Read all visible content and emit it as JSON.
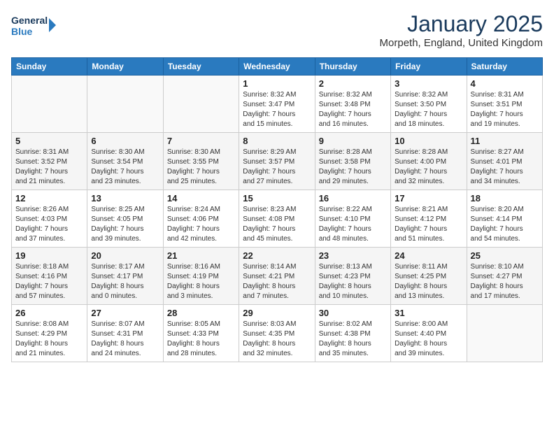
{
  "header": {
    "logo_line1": "General",
    "logo_line2": "Blue",
    "title": "January 2025",
    "subtitle": "Morpeth, England, United Kingdom"
  },
  "weekdays": [
    "Sunday",
    "Monday",
    "Tuesday",
    "Wednesday",
    "Thursday",
    "Friday",
    "Saturday"
  ],
  "weeks": [
    [
      {
        "day": "",
        "info": ""
      },
      {
        "day": "",
        "info": ""
      },
      {
        "day": "",
        "info": ""
      },
      {
        "day": "1",
        "info": "Sunrise: 8:32 AM\nSunset: 3:47 PM\nDaylight: 7 hours\nand 15 minutes."
      },
      {
        "day": "2",
        "info": "Sunrise: 8:32 AM\nSunset: 3:48 PM\nDaylight: 7 hours\nand 16 minutes."
      },
      {
        "day": "3",
        "info": "Sunrise: 8:32 AM\nSunset: 3:50 PM\nDaylight: 7 hours\nand 18 minutes."
      },
      {
        "day": "4",
        "info": "Sunrise: 8:31 AM\nSunset: 3:51 PM\nDaylight: 7 hours\nand 19 minutes."
      }
    ],
    [
      {
        "day": "5",
        "info": "Sunrise: 8:31 AM\nSunset: 3:52 PM\nDaylight: 7 hours\nand 21 minutes."
      },
      {
        "day": "6",
        "info": "Sunrise: 8:30 AM\nSunset: 3:54 PM\nDaylight: 7 hours\nand 23 minutes."
      },
      {
        "day": "7",
        "info": "Sunrise: 8:30 AM\nSunset: 3:55 PM\nDaylight: 7 hours\nand 25 minutes."
      },
      {
        "day": "8",
        "info": "Sunrise: 8:29 AM\nSunset: 3:57 PM\nDaylight: 7 hours\nand 27 minutes."
      },
      {
        "day": "9",
        "info": "Sunrise: 8:28 AM\nSunset: 3:58 PM\nDaylight: 7 hours\nand 29 minutes."
      },
      {
        "day": "10",
        "info": "Sunrise: 8:28 AM\nSunset: 4:00 PM\nDaylight: 7 hours\nand 32 minutes."
      },
      {
        "day": "11",
        "info": "Sunrise: 8:27 AM\nSunset: 4:01 PM\nDaylight: 7 hours\nand 34 minutes."
      }
    ],
    [
      {
        "day": "12",
        "info": "Sunrise: 8:26 AM\nSunset: 4:03 PM\nDaylight: 7 hours\nand 37 minutes."
      },
      {
        "day": "13",
        "info": "Sunrise: 8:25 AM\nSunset: 4:05 PM\nDaylight: 7 hours\nand 39 minutes."
      },
      {
        "day": "14",
        "info": "Sunrise: 8:24 AM\nSunset: 4:06 PM\nDaylight: 7 hours\nand 42 minutes."
      },
      {
        "day": "15",
        "info": "Sunrise: 8:23 AM\nSunset: 4:08 PM\nDaylight: 7 hours\nand 45 minutes."
      },
      {
        "day": "16",
        "info": "Sunrise: 8:22 AM\nSunset: 4:10 PM\nDaylight: 7 hours\nand 48 minutes."
      },
      {
        "day": "17",
        "info": "Sunrise: 8:21 AM\nSunset: 4:12 PM\nDaylight: 7 hours\nand 51 minutes."
      },
      {
        "day": "18",
        "info": "Sunrise: 8:20 AM\nSunset: 4:14 PM\nDaylight: 7 hours\nand 54 minutes."
      }
    ],
    [
      {
        "day": "19",
        "info": "Sunrise: 8:18 AM\nSunset: 4:16 PM\nDaylight: 7 hours\nand 57 minutes."
      },
      {
        "day": "20",
        "info": "Sunrise: 8:17 AM\nSunset: 4:17 PM\nDaylight: 8 hours\nand 0 minutes."
      },
      {
        "day": "21",
        "info": "Sunrise: 8:16 AM\nSunset: 4:19 PM\nDaylight: 8 hours\nand 3 minutes."
      },
      {
        "day": "22",
        "info": "Sunrise: 8:14 AM\nSunset: 4:21 PM\nDaylight: 8 hours\nand 7 minutes."
      },
      {
        "day": "23",
        "info": "Sunrise: 8:13 AM\nSunset: 4:23 PM\nDaylight: 8 hours\nand 10 minutes."
      },
      {
        "day": "24",
        "info": "Sunrise: 8:11 AM\nSunset: 4:25 PM\nDaylight: 8 hours\nand 13 minutes."
      },
      {
        "day": "25",
        "info": "Sunrise: 8:10 AM\nSunset: 4:27 PM\nDaylight: 8 hours\nand 17 minutes."
      }
    ],
    [
      {
        "day": "26",
        "info": "Sunrise: 8:08 AM\nSunset: 4:29 PM\nDaylight: 8 hours\nand 21 minutes."
      },
      {
        "day": "27",
        "info": "Sunrise: 8:07 AM\nSunset: 4:31 PM\nDaylight: 8 hours\nand 24 minutes."
      },
      {
        "day": "28",
        "info": "Sunrise: 8:05 AM\nSunset: 4:33 PM\nDaylight: 8 hours\nand 28 minutes."
      },
      {
        "day": "29",
        "info": "Sunrise: 8:03 AM\nSunset: 4:35 PM\nDaylight: 8 hours\nand 32 minutes."
      },
      {
        "day": "30",
        "info": "Sunrise: 8:02 AM\nSunset: 4:38 PM\nDaylight: 8 hours\nand 35 minutes."
      },
      {
        "day": "31",
        "info": "Sunrise: 8:00 AM\nSunset: 4:40 PM\nDaylight: 8 hours\nand 39 minutes."
      },
      {
        "day": "",
        "info": ""
      }
    ]
  ]
}
